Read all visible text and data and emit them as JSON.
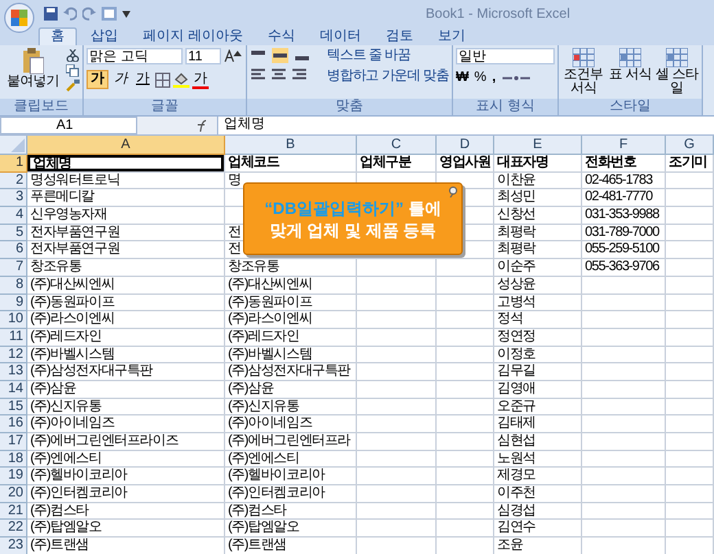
{
  "window": {
    "title": "Book1 - Microsoft Excel"
  },
  "tabs": [
    {
      "label": "홈",
      "selected": true
    },
    {
      "label": "삽입",
      "selected": false
    },
    {
      "label": "페이지 레이아웃",
      "selected": false
    },
    {
      "label": "수식",
      "selected": false
    },
    {
      "label": "데이터",
      "selected": false
    },
    {
      "label": "검토",
      "selected": false
    },
    {
      "label": "보기",
      "selected": false
    }
  ],
  "ribbon": {
    "clipboard": {
      "label": "클립보드",
      "paste": "붙여넣기"
    },
    "font": {
      "label": "글꼴",
      "font_name": "맑은 고딕",
      "font_size": "11",
      "bold": "가",
      "italic": "가",
      "underline": "가",
      "font_color": "가"
    },
    "alignment": {
      "label": "맞춤",
      "wrap": "텍스트 줄 바꿈",
      "merge": "병합하고 가운데 맞춤"
    },
    "number": {
      "label": "표시 형식",
      "format": "일반",
      "currency": "₩",
      "percent": "%",
      "comma": ","
    },
    "styles": {
      "label": "스타일",
      "buttons": [
        "조건부 서식",
        "표 서식",
        "셀 스타일"
      ]
    }
  },
  "name_box": "A1",
  "formula": "업체명",
  "columns": [
    {
      "label": "A",
      "selected": true
    },
    {
      "label": "B",
      "selected": false
    },
    {
      "label": "C",
      "selected": false
    },
    {
      "label": "D",
      "selected": false
    },
    {
      "label": "E",
      "selected": false
    },
    {
      "label": "F",
      "selected": false
    },
    {
      "label": "G",
      "selected": false
    }
  ],
  "rows": [
    {
      "number": "1",
      "selected": true,
      "cells": [
        "업체명",
        "업체코드",
        "업체구분",
        "영업사원",
        "대표자명",
        "전화번호",
        "조기미"
      ]
    },
    {
      "number": "2",
      "selected": false,
      "cells": [
        "명성워터트로닉",
        "명",
        "",
        "",
        "이찬윤",
        "02-465-1783",
        ""
      ]
    },
    {
      "number": "3",
      "selected": false,
      "cells": [
        "푸른메디칼",
        "",
        "",
        "",
        "최성민",
        "02-481-7770",
        ""
      ]
    },
    {
      "number": "4",
      "selected": false,
      "cells": [
        "신우영농자재",
        "",
        "",
        "",
        "신창선",
        "031-353-9988",
        ""
      ]
    },
    {
      "number": "5",
      "selected": false,
      "cells": [
        "전자부품연구원",
        "전",
        "",
        "",
        "최평락",
        "031-789-7000",
        ""
      ]
    },
    {
      "number": "6",
      "selected": false,
      "cells": [
        "전자부품연구원",
        "전",
        "",
        "",
        "최평락",
        "055-259-5100",
        ""
      ]
    },
    {
      "number": "7",
      "selected": false,
      "cells": [
        "창조유통",
        "창조유통",
        "",
        "",
        "이순주",
        "055-363-9706",
        ""
      ]
    },
    {
      "number": "8",
      "selected": false,
      "cells": [
        "(주)대산씨엔씨",
        "(주)대산씨엔씨",
        "",
        "",
        "성상윤",
        "",
        ""
      ]
    },
    {
      "number": "9",
      "selected": false,
      "cells": [
        "(주)동원파이프",
        "(주)동원파이프",
        "",
        "",
        "고병석",
        "",
        ""
      ]
    },
    {
      "number": "10",
      "selected": false,
      "cells": [
        "(주)라스이엔씨",
        "(주)라스이엔씨",
        "",
        "",
        "정석",
        "",
        ""
      ]
    },
    {
      "number": "11",
      "selected": false,
      "cells": [
        "(주)레드자인",
        "(주)레드자인",
        "",
        "",
        "정연정",
        "",
        ""
      ]
    },
    {
      "number": "12",
      "selected": false,
      "cells": [
        "(주)바벨시스템",
        "(주)바벨시스템",
        "",
        "",
        "이정호",
        "",
        ""
      ]
    },
    {
      "number": "13",
      "selected": false,
      "cells": [
        "(주)삼성전자대구특판",
        "(주)삼성전자대구특판",
        "",
        "",
        "김무길",
        "",
        ""
      ]
    },
    {
      "number": "14",
      "selected": false,
      "cells": [
        "(주)삼윤",
        "(주)삼윤",
        "",
        "",
        "김영애",
        "",
        ""
      ]
    },
    {
      "number": "15",
      "selected": false,
      "cells": [
        "(주)신지유통",
        "(주)신지유통",
        "",
        "",
        "오준규",
        "",
        ""
      ]
    },
    {
      "number": "16",
      "selected": false,
      "cells": [
        "(주)아이네임즈",
        "(주)아이네임즈",
        "",
        "",
        "김태제",
        "",
        ""
      ]
    },
    {
      "number": "17",
      "selected": false,
      "cells": [
        "(주)에버그린엔터프라이즈",
        "(주)에버그린엔터프라",
        "",
        "",
        "심현섭",
        "",
        ""
      ]
    },
    {
      "number": "18",
      "selected": false,
      "cells": [
        "(주)엔에스티",
        "(주)엔에스티",
        "",
        "",
        "노원석",
        "",
        ""
      ]
    },
    {
      "number": "19",
      "selected": false,
      "cells": [
        "(주)헬바이코리아",
        "(주)헬바이코리아",
        "",
        "",
        "제경모",
        "",
        ""
      ]
    },
    {
      "number": "20",
      "selected": false,
      "cells": [
        "(주)인터켐코리아",
        "(주)인터켐코리아",
        "",
        "",
        "이주천",
        "",
        ""
      ]
    },
    {
      "number": "21",
      "selected": false,
      "cells": [
        "(주)컴스타",
        "(주)컴스타",
        "",
        "",
        "심경섭",
        "",
        ""
      ]
    },
    {
      "number": "22",
      "selected": false,
      "cells": [
        "(주)탑엠알오",
        "(주)탑엠알오",
        "",
        "",
        "김연수",
        "",
        ""
      ]
    },
    {
      "number": "23",
      "selected": false,
      "cells": [
        "(주)트랜샘",
        "(주)트랜샘",
        "",
        "",
        "조윤",
        "",
        ""
      ]
    }
  ],
  "callout": {
    "highlight": "“DB일괄입력하기”",
    "line1_rest": "틀에",
    "line2": "맞게 업체 및 제품 등록"
  }
}
